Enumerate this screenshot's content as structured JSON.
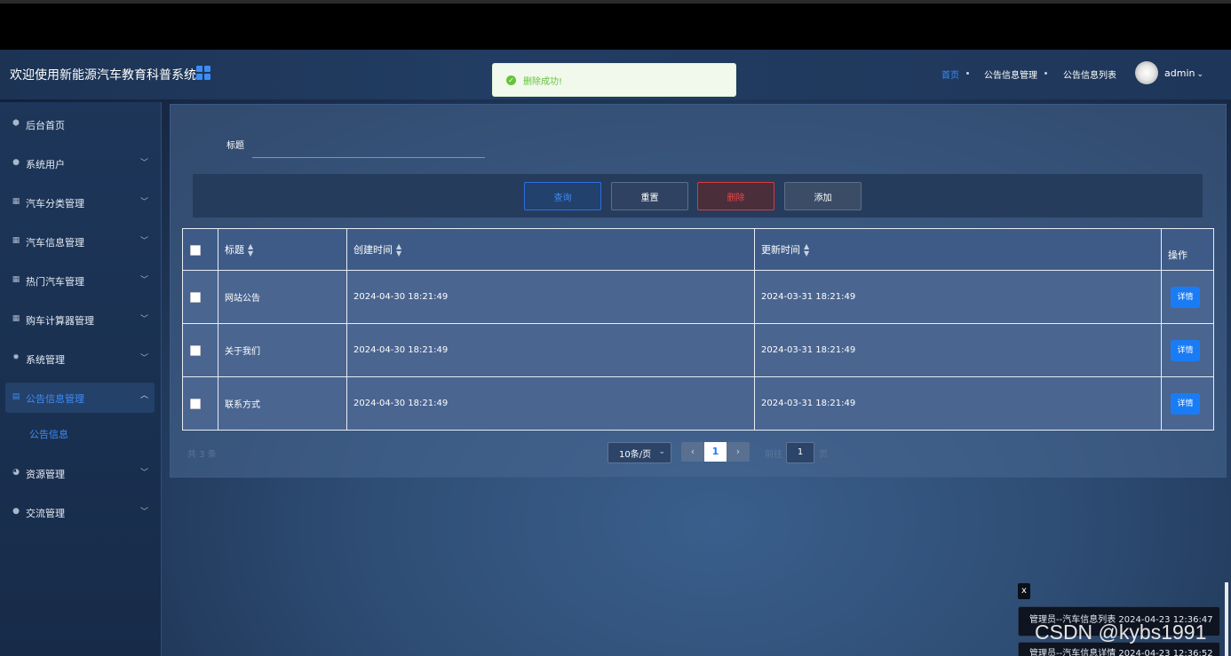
{
  "app": {
    "title": "欢迎使用新能源汽车教育科普系统",
    "accent_color": "#3d8cf5"
  },
  "toast": {
    "message": "删除成功!",
    "type": "success",
    "color": "#67c23a"
  },
  "topnav": {
    "items": [
      {
        "label": "首页",
        "active": true
      },
      {
        "label": "公告信息管理",
        "active": false
      },
      {
        "label": "公告信息列表",
        "active": false
      }
    ],
    "user": "admin",
    "user_caret": "⌄"
  },
  "sidebar": {
    "items": [
      {
        "label": "后台首页",
        "icon": "home-icon",
        "expandable": false
      },
      {
        "label": "系统用户",
        "icon": "user-icon",
        "expandable": true
      },
      {
        "label": "汽车分类管理",
        "icon": "apps-icon",
        "expandable": true
      },
      {
        "label": "汽车信息管理",
        "icon": "apps-icon",
        "expandable": true
      },
      {
        "label": "热门汽车管理",
        "icon": "apps-icon",
        "expandable": true
      },
      {
        "label": "购车计算器管理",
        "icon": "apps-icon",
        "expandable": true
      },
      {
        "label": "系统管理",
        "icon": "gear-icon",
        "expandable": true
      },
      {
        "label": "公告信息管理",
        "icon": "document-icon",
        "expandable": true,
        "active": true,
        "expanded": true
      },
      {
        "label": "资源管理",
        "icon": "pie-chart-icon",
        "expandable": true
      },
      {
        "label": "交流管理",
        "icon": "chat-icon",
        "expandable": true
      }
    ],
    "submenu_label": "公告信息"
  },
  "search": {
    "label": "标题",
    "value": "",
    "placeholder": ""
  },
  "toolbar": {
    "query_label": "查询",
    "reset_label": "重置",
    "delete_label": "删除",
    "add_label": "添加"
  },
  "table": {
    "columns": [
      "标题",
      "创建时间",
      "更新时间",
      "操作"
    ],
    "rows": [
      {
        "title": "网站公告",
        "created": "2024-04-30 18:21:49",
        "updated": "2024-03-31 18:21:49",
        "action": "详情"
      },
      {
        "title": "关于我们",
        "created": "2024-04-30 18:21:49",
        "updated": "2024-03-31 18:21:49",
        "action": "详情"
      },
      {
        "title": "联系方式",
        "created": "2024-04-30 18:21:49",
        "updated": "2024-03-31 18:21:49",
        "action": "详情"
      }
    ]
  },
  "pagination": {
    "total_text": "共 3 条",
    "page_size": "10条/页",
    "current_page": "1",
    "goto_label": "前往",
    "goto_value": "1",
    "page_word": "页"
  },
  "log_panel": {
    "close_label": "x",
    "entries": [
      "管理员--汽车信息列表 2024-04-23 12:36:47",
      "管理员--汽车信息详情 2024-04-23 12:36:52"
    ]
  },
  "watermark": "CSDN @kybs1991"
}
